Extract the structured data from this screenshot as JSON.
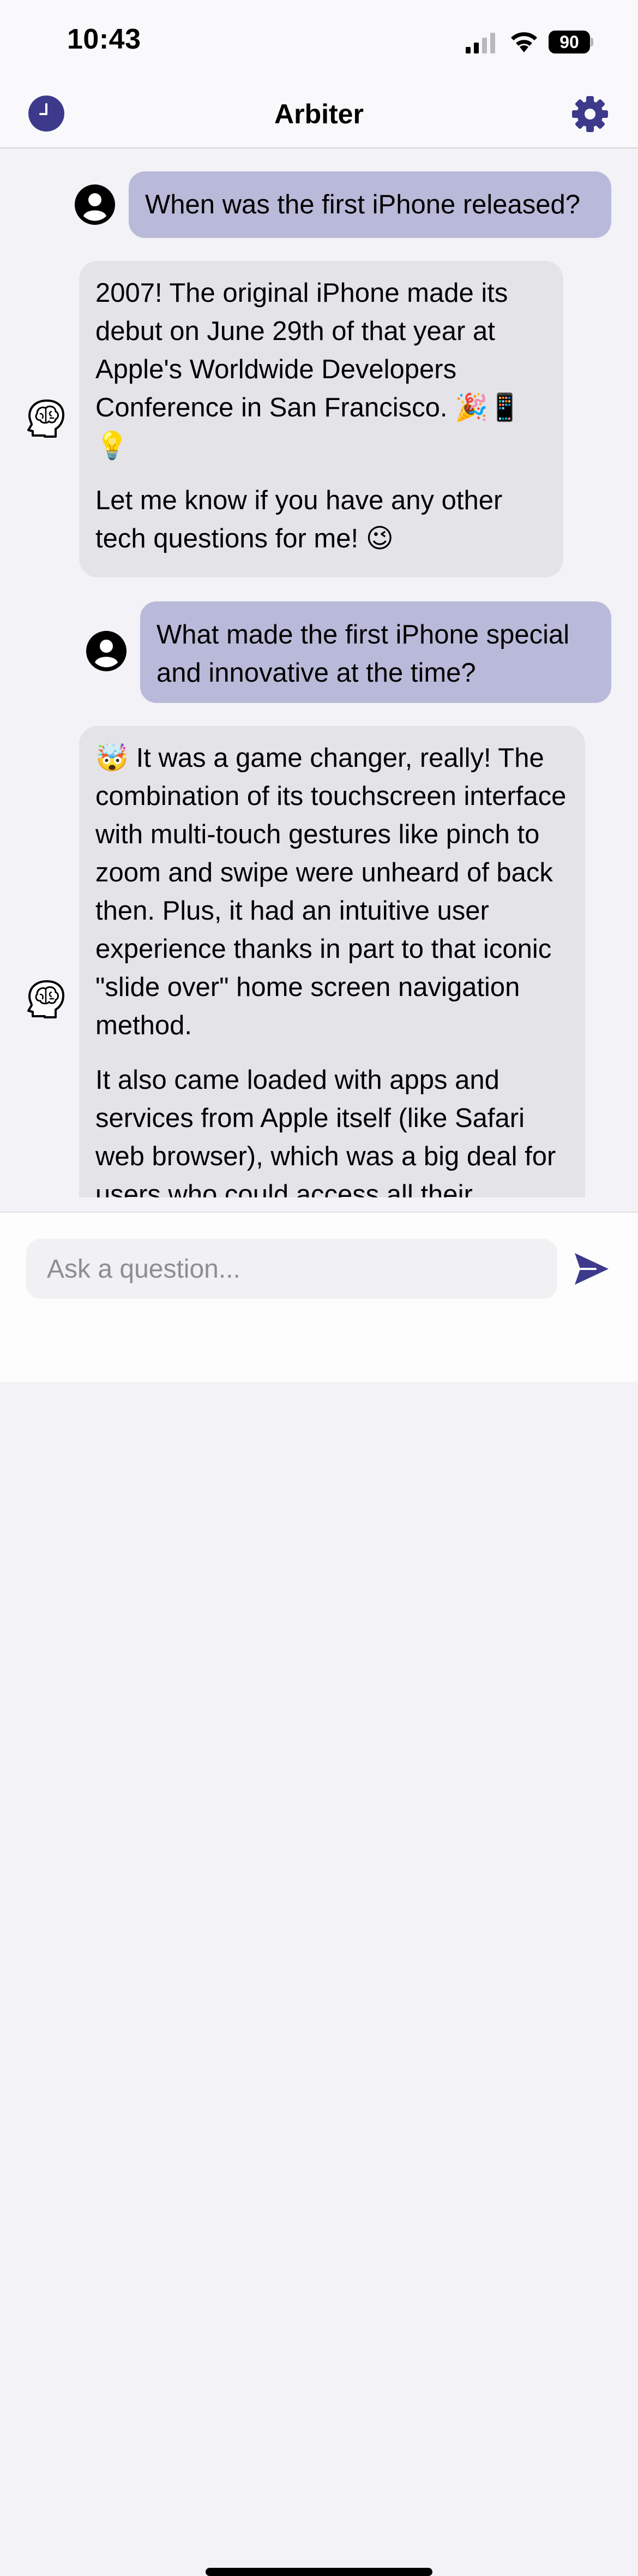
{
  "status_bar": {
    "time": "10:43",
    "battery_level": "90"
  },
  "nav": {
    "title": "Arbiter",
    "history_icon": "clock-icon",
    "settings_icon": "gear-icon"
  },
  "messages": [
    {
      "role": "user",
      "avatar_icon": "person-circle-icon",
      "text": "When was the first iPhone released?"
    },
    {
      "role": "assistant",
      "avatar_icon": "brain-head-icon",
      "paragraphs": [
        "2007! The original iPhone made its debut on June 29th of that year at Apple's Worldwide Developers Conference in San Francisco. 🎉📱💡",
        "Let me know if you have any other tech questions for me! 😉"
      ]
    },
    {
      "role": "user",
      "avatar_icon": "person-circle-icon",
      "text": "What made the first iPhone special and innovative at the time?"
    },
    {
      "role": "assistant",
      "avatar_icon": "brain-head-icon",
      "paragraphs": [
        "🤯 It was a game changer, really! The combination of its touchscreen interface with multi-touch gestures like pinch to zoom and swipe were unheard of back then. Plus, it had an intuitive user experience thanks in part to that iconic \"slide over\" home screen navigation method.",
        "It also came loaded with apps and services from Apple itself (like Safari web browser), which was a big deal for users who could access all their"
      ]
    }
  ],
  "composer": {
    "placeholder": "Ask a question...",
    "value": "",
    "send_icon": "send-icon"
  },
  "colors": {
    "accent": "#3d3a8c",
    "user_bubble": "#b9b9d9",
    "assistant_bubble": "#e3e3e8",
    "background": "#f2f2f7"
  }
}
